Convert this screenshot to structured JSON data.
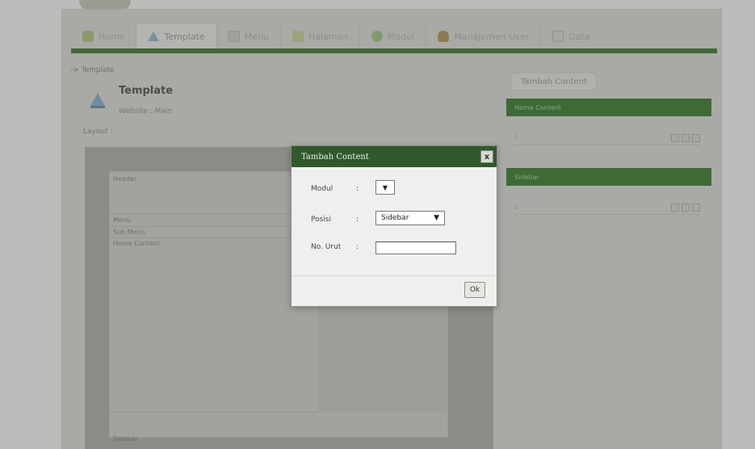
{
  "nav": {
    "items": [
      {
        "label": "Home",
        "icon": "home-icon"
      },
      {
        "label": "Template",
        "icon": "template-icon",
        "active": true
      },
      {
        "label": "Menu",
        "icon": "menu-icon"
      },
      {
        "label": "Halaman",
        "icon": "page-icon"
      },
      {
        "label": "Modul",
        "icon": "module-icon"
      },
      {
        "label": "Manajemen User",
        "icon": "user-icon"
      },
      {
        "label": "Data",
        "icon": "data-icon"
      }
    ]
  },
  "breadcrumb": "-> Template",
  "page": {
    "title": "Template",
    "subtitle": "Website : Main",
    "layout_label": "Layout :"
  },
  "layout": {
    "header": "Header",
    "menu": "Menu",
    "submenu": "Sub Menu",
    "home_content": "Home Content",
    "sidebar": "Sidebar"
  },
  "right": {
    "tambah_button": "Tambah Content",
    "section_home": "Home Content",
    "section_sidebar": "Sidebar",
    "row_home": "1",
    "row_sidebar": "1"
  },
  "modal": {
    "title": "Tambah Content",
    "close": "x",
    "modul_label": "Modul",
    "posisi_label": "Posisi",
    "nourut_label": "No. Urut",
    "colon": ":",
    "modul_value": "▼",
    "posisi_value": "Sidebar",
    "posisi_arrow": "▼",
    "nourut_value": "",
    "ok": "Ok"
  },
  "colors": {
    "accent_green": "#2f5a2b",
    "nav_track": "#3f6a34"
  }
}
